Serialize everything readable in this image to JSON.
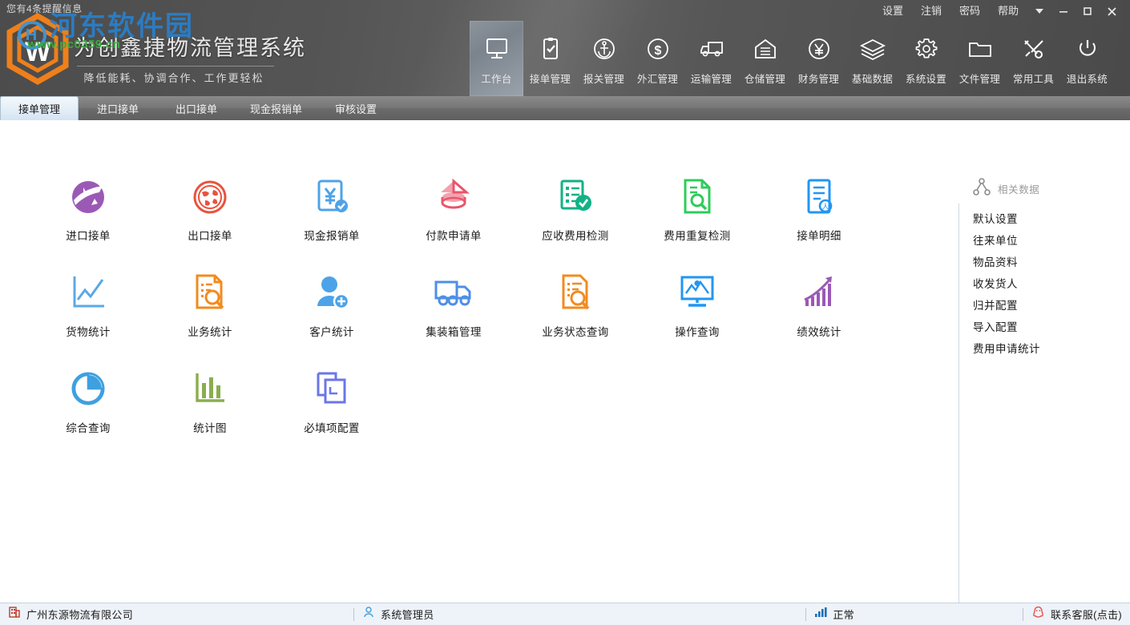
{
  "window": {
    "notice": "您有4条提醒信息",
    "menus": [
      {
        "label": "设置",
        "name": "settings"
      },
      {
        "label": "注销",
        "name": "logout"
      },
      {
        "label": "密码",
        "name": "password"
      },
      {
        "label": "帮助",
        "name": "help"
      }
    ],
    "buttons": [
      {
        "name": "dropdown-icon",
        "glyph": "▼"
      },
      {
        "name": "minimize-icon",
        "glyph": "—"
      },
      {
        "name": "maximize-icon",
        "glyph": "▫"
      },
      {
        "name": "close-icon",
        "glyph": "✕"
      }
    ]
  },
  "brand": {
    "title": "为创鑫捷物流管理系统",
    "subtitle": "降低能耗、协调合作、工作更轻松",
    "logo_letter": "W",
    "watermark_site": "河东软件园",
    "watermark_url": "www.pc0359.cn"
  },
  "toolbar": {
    "items": [
      {
        "label": "工作台",
        "icon": "monitor-icon",
        "active": true
      },
      {
        "label": "接单管理",
        "icon": "clipboard-check-icon",
        "active": false
      },
      {
        "label": "报关管理",
        "icon": "anchor-circle-icon",
        "active": false
      },
      {
        "label": "外汇管理",
        "icon": "dollar-circle-icon",
        "active": false
      },
      {
        "label": "运输管理",
        "icon": "truck-icon",
        "active": false
      },
      {
        "label": "仓储管理",
        "icon": "warehouse-icon",
        "active": false
      },
      {
        "label": "财务管理",
        "icon": "yen-circle-icon",
        "active": false
      },
      {
        "label": "基础数据",
        "icon": "layers-icon",
        "active": false
      },
      {
        "label": "系统设置",
        "icon": "gear-icon",
        "active": false
      },
      {
        "label": "文件管理",
        "icon": "folder-icon",
        "active": false
      },
      {
        "label": "常用工具",
        "icon": "tools-icon",
        "active": false
      },
      {
        "label": "退出系统",
        "icon": "power-icon",
        "active": false
      }
    ]
  },
  "tabs": [
    {
      "label": "接单管理",
      "active": true
    },
    {
      "label": "进口接单",
      "active": false
    },
    {
      "label": "出口接单",
      "active": false
    },
    {
      "label": "现金报销单",
      "active": false
    },
    {
      "label": "审核设置",
      "active": false
    }
  ],
  "workspace": {
    "rows": [
      [
        {
          "label": "进口接单",
          "icon": "globe-plane-icon",
          "color": "#9b59b6"
        },
        {
          "label": "出口接单",
          "icon": "globe-stamp-icon",
          "color": "#e8533d"
        },
        {
          "label": "现金报销单",
          "icon": "yen-doc-check-icon",
          "color": "#4da3e8"
        },
        {
          "label": "付款申请单",
          "icon": "payment-stack-icon",
          "color": "#e8566b"
        },
        {
          "label": "应收费用检测",
          "icon": "doc-check-icon",
          "color": "#12b286"
        },
        {
          "label": "费用重复检测",
          "icon": "doc-search-icon",
          "color": "#2ecc5a"
        },
        {
          "label": "接单明细",
          "icon": "doc-lines-icon",
          "color": "#2196f3"
        }
      ],
      [
        {
          "label": "货物统计",
          "icon": "line-chart-icon",
          "color": "#5aa9e6"
        },
        {
          "label": "业务统计",
          "icon": "doc-magnifier-icon",
          "color": "#f28b20"
        },
        {
          "label": "客户统计",
          "icon": "user-add-icon",
          "color": "#4da3e8"
        },
        {
          "label": "集装箱管理",
          "icon": "container-truck-icon",
          "color": "#4d8fe8"
        },
        {
          "label": "业务状态查询",
          "icon": "form-search-icon",
          "color": "#f28b20"
        },
        {
          "label": "操作查询",
          "icon": "monitor-chart-icon",
          "color": "#2196f3"
        },
        {
          "label": "绩效统计",
          "icon": "growth-arrow-icon",
          "color": "#9b59b6"
        }
      ],
      [
        {
          "label": "综合查询",
          "icon": "pie-chart-icon",
          "color": "#3fa0e0"
        },
        {
          "label": "统计图",
          "icon": "bar-chart-icon",
          "color": "#8aad4e"
        },
        {
          "label": "必填项配置",
          "icon": "copy-squares-icon",
          "color": "#6b76e8"
        }
      ]
    ]
  },
  "related_panel": {
    "title": "相关数据",
    "icon": "network-node-icon",
    "items": [
      {
        "label": "默认设置"
      },
      {
        "label": "往来单位"
      },
      {
        "label": "物品资料"
      },
      {
        "label": "收发货人"
      },
      {
        "label": "归并配置"
      },
      {
        "label": "导入配置"
      },
      {
        "label": "费用申请统计"
      }
    ]
  },
  "statusbar": {
    "company": "广州东源物流有限公司",
    "company_icon": "building-icon",
    "user": "系统管理员",
    "user_icon": "person-icon",
    "connection": "正常",
    "connection_icon": "signal-bars-icon",
    "support": "联系客服(点击)",
    "support_icon": "qq-penguin-icon"
  },
  "colors": {
    "header_bg": "#555555",
    "tabbar_bg": "#767676",
    "tab_active_bg": "#e4eef7",
    "status_bg": "#eef3f9",
    "status_accent": "#1464a5"
  }
}
